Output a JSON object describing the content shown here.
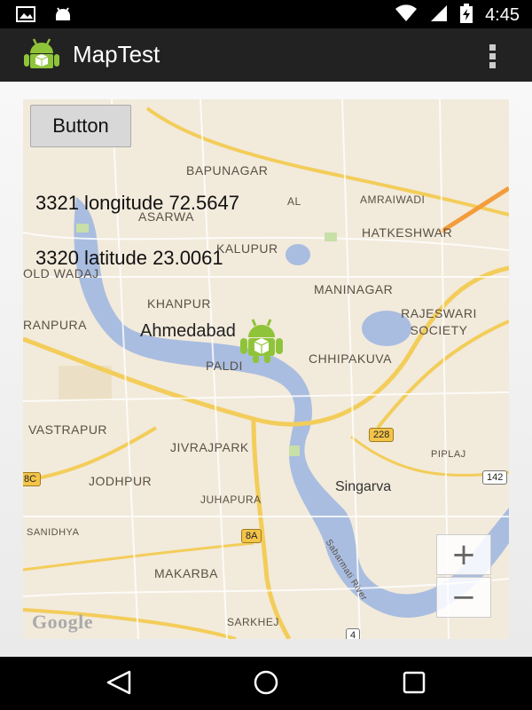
{
  "status_bar": {
    "time": "4:45",
    "icons": [
      "image-icon",
      "android-debug-icon",
      "wifi-icon",
      "signal-icon",
      "battery-charging-icon"
    ]
  },
  "action_bar": {
    "title": "MapTest",
    "app_icon": "android-icon",
    "overflow_icon": "overflow-menu-icon"
  },
  "map": {
    "button_label": "Button",
    "longitude_text": "3321 longitude 72.5647",
    "latitude_text": "3320 latitude 23.0061",
    "city_label": "Ahmedabad",
    "zoom_in": "+",
    "zoom_out": "−",
    "attribution": "Google",
    "place_labels": {
      "bapunagar": "BAPUNAGAR",
      "amraiwadi": "AMRAIWADI",
      "asarwa": "ASARWA",
      "hatkeshwar": "HATKESHWAR",
      "kalupur": "KALUPUR",
      "old_wadaj": "OLD WADAJ",
      "maninagar": "MANINAGAR",
      "khanpur": "KHANPUR",
      "rajeswari_society": "RAJESWARI SOCIETY",
      "ranpura": "RANPURA",
      "paldi": "PALDI",
      "chhipakuva": "CHHIPAKUVA",
      "vastrapur": "VASTRAPUR",
      "jivrajpark": "JIVRAJPARK",
      "piplaj": "PIPLAJ",
      "jodhpur": "JODHPUR",
      "singarva": "Singarva",
      "juhapura": "JUHAPURA",
      "sanidhya": "SANIDHYA",
      "sabarmati_river": "Sabarmati River",
      "makarba": "MAKARBA",
      "sarkhej": "SARKHEJ",
      "sakhal": "AL"
    },
    "road_shields": {
      "s228": "228",
      "s142": "142",
      "s8a": "8A",
      "s8c": "8C",
      "s4": "4"
    }
  },
  "nav_bar": {
    "back_icon": "back-icon",
    "home_icon": "home-icon",
    "recents_icon": "recents-icon"
  }
}
